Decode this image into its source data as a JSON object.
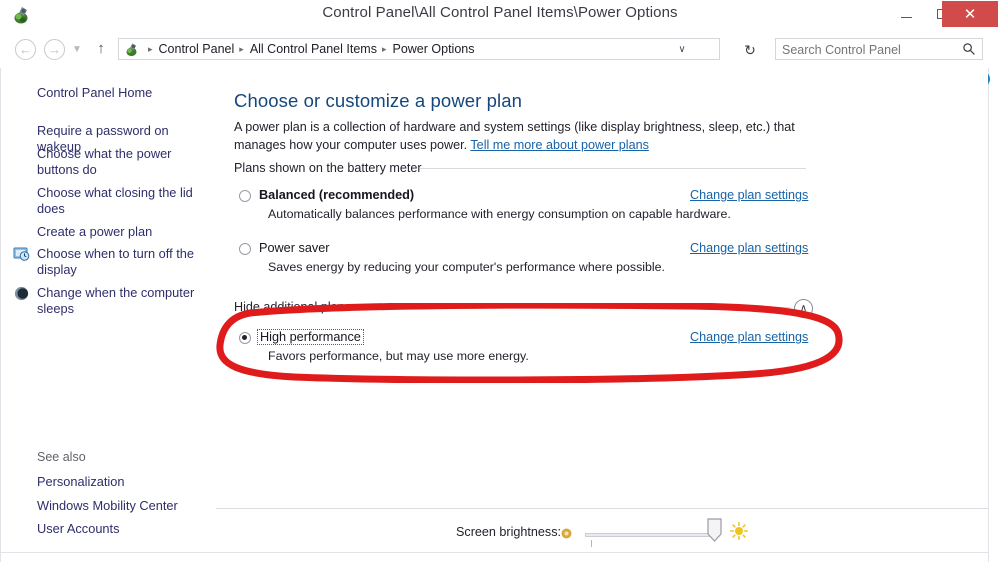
{
  "window": {
    "title": "Control Panel\\All Control Panel Items\\Power Options",
    "icon": "control-panel-icon",
    "minimize_label": "–",
    "maximize_label": "❑",
    "close_label": "✕"
  },
  "navbar": {
    "back_label": "←",
    "forward_label": "→",
    "recent_label": "▼",
    "up_label": "↑",
    "breadcrumb": [
      "Control Panel",
      "All Control Panel Items",
      "Power Options"
    ],
    "breadcrumb_separator": "▸",
    "dropdown_label": "∨",
    "refresh_label": "↻",
    "search": {
      "placeholder": "Search Control Panel",
      "value": "",
      "icon": "search-icon"
    }
  },
  "help": {
    "label": "?"
  },
  "sidebar": {
    "home_label": "Control Panel Home",
    "items": [
      {
        "label": "Require a password on wakeup",
        "icon": null
      },
      {
        "label": "Choose what the power buttons do",
        "icon": null
      },
      {
        "label": "Choose what closing the lid does",
        "icon": null
      },
      {
        "label": "Create a power plan",
        "icon": null
      },
      {
        "label": "Choose when to turn off the display",
        "icon": "display-clock-icon"
      },
      {
        "label": "Change when the computer sleeps",
        "icon": "sleep-moon-icon"
      }
    ],
    "see_also_label": "See also",
    "see_also_items": [
      {
        "label": "Personalization"
      },
      {
        "label": "Windows Mobility Center"
      },
      {
        "label": "User Accounts"
      }
    ]
  },
  "main": {
    "title": "Choose or customize a power plan",
    "description_part1": "A power plan is a collection of hardware and system settings (like display brightness, sleep, etc.) that manages how your computer uses power. ",
    "description_link": "Tell me more about power plans",
    "group_label": "Plans shown on the battery meter",
    "additional_label": "Hide additional plans",
    "collapse_icon_label": "∧",
    "plans": [
      {
        "name": "Balanced (recommended)",
        "description": "Automatically balances performance with energy consumption on capable hardware.",
        "change_label": "Change plan settings",
        "selected": false,
        "bold": true,
        "focused": false
      },
      {
        "name": "Power saver",
        "description": "Saves energy by reducing your computer's performance where possible.",
        "change_label": "Change plan settings",
        "selected": false,
        "bold": false,
        "focused": false
      },
      {
        "name": "High performance",
        "description": "Favors performance, but may use more energy.",
        "change_label": "Change plan settings",
        "selected": true,
        "bold": false,
        "focused": true
      }
    ]
  },
  "brightness": {
    "label": "Screen brightness:",
    "dim_icon": "dim-sun-icon",
    "bright_icon": "bright-sun-icon",
    "value_percent": 92
  },
  "annotation": {
    "shape": "red-ellipse-highlight",
    "color": "#e01b1b"
  },
  "colors": {
    "accent_link": "#1763a8",
    "title_blue": "#13477e",
    "sidebar_link": "#2e2e6b",
    "close_red": "#d24b4b",
    "annotation_red": "#e01b1b"
  }
}
